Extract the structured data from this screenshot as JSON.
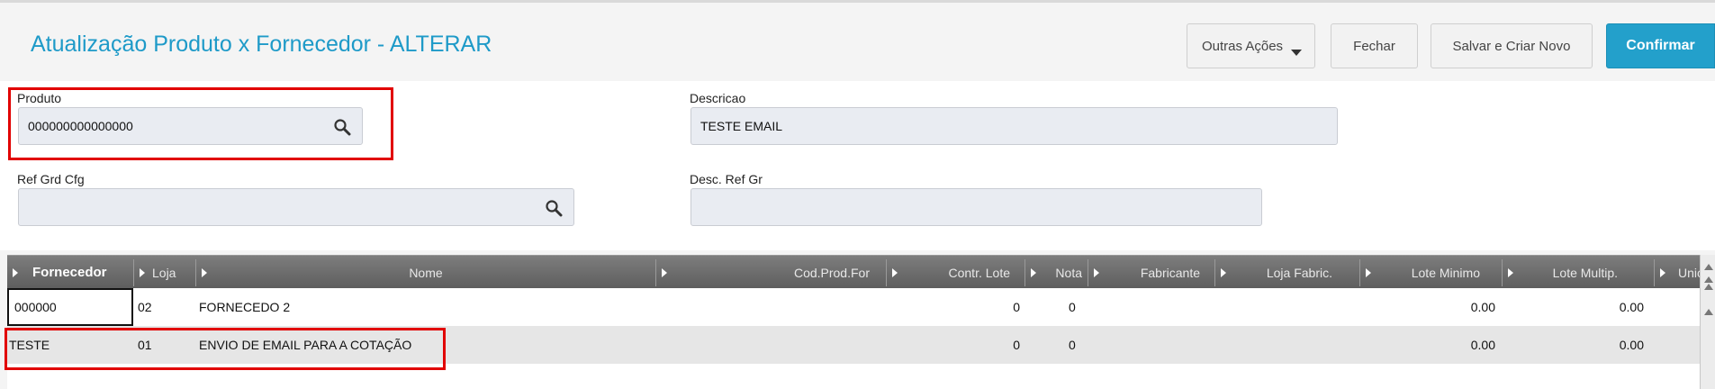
{
  "header": {
    "title": "Atualização Produto x Fornecedor - ALTERAR",
    "buttons": {
      "outras_acoes": "Outras Ações",
      "fechar": "Fechar",
      "salvar_criar_novo": "Salvar e Criar Novo",
      "confirmar": "Confirmar"
    },
    "accent_color": "#23a0cb"
  },
  "form": {
    "produto": {
      "label": "Produto",
      "value": "000000000000000",
      "icon": "search-icon"
    },
    "descricao": {
      "label": "Descricao",
      "value": "TESTE EMAIL"
    },
    "ref_grd_cfg": {
      "label": "Ref Grd Cfg",
      "value": "",
      "icon": "search-icon"
    },
    "desc_ref_gr": {
      "label": "Desc. Ref Gr",
      "value": ""
    }
  },
  "grid": {
    "columns": [
      "Fornecedor",
      "Loja",
      "Nome",
      "Cod.Prod.For",
      "Contr. Lote",
      "Nota",
      "Fabricante",
      "Loja Fabric.",
      "Lote Minimo",
      "Lote Multip.",
      "Unic"
    ],
    "rows": [
      {
        "fornecedor": "000000",
        "loja": "02",
        "nome": "FORNECEDO 2",
        "cod_prod_for": "",
        "contr_lote": "0",
        "nota": "0",
        "fabricante": "",
        "loja_fabric": "",
        "lote_minimo": "0.00",
        "lote_multip": "0.00"
      },
      {
        "fornecedor": "TESTE",
        "loja": "01",
        "nome": "ENVIO DE EMAIL PARA A COTAÇÃO",
        "cod_prod_for": "",
        "contr_lote": "0",
        "nota": "0",
        "fabricante": "",
        "loja_fabric": "",
        "lote_minimo": "0.00",
        "lote_multip": "0.00"
      }
    ]
  },
  "highlight_color": "#e10000"
}
